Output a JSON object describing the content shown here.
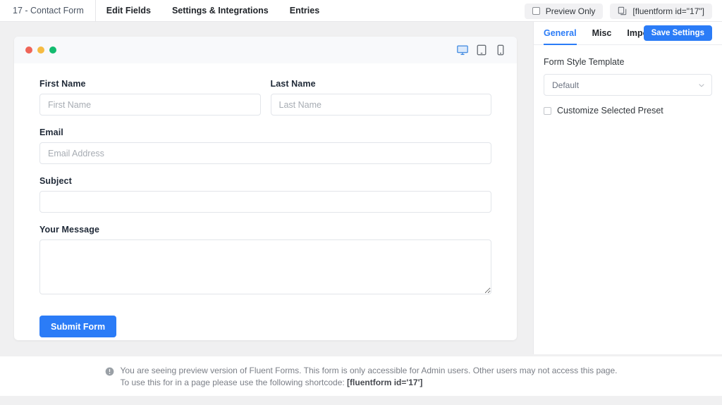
{
  "topbar": {
    "form_title": "17 - Contact Form",
    "nav": [
      {
        "label": "Edit Fields"
      },
      {
        "label": "Settings & Integrations"
      },
      {
        "label": "Entries"
      }
    ],
    "preview_only_label": "Preview Only",
    "shortcode_pill_label": "[fluentform id=\"17\"]"
  },
  "preview": {
    "devices": [
      {
        "name": "desktop",
        "active": true
      },
      {
        "name": "tablet",
        "active": false
      },
      {
        "name": "mobile",
        "active": false
      }
    ]
  },
  "form": {
    "first_name": {
      "label": "First Name",
      "placeholder": "First Name",
      "value": ""
    },
    "last_name": {
      "label": "Last Name",
      "placeholder": "Last Name",
      "value": ""
    },
    "email": {
      "label": "Email",
      "placeholder": "Email Address",
      "value": ""
    },
    "subject": {
      "label": "Subject",
      "placeholder": "",
      "value": ""
    },
    "message": {
      "label": "Your Message",
      "placeholder": "",
      "value": ""
    },
    "submit_label": "Submit Form"
  },
  "panel": {
    "tabs": [
      {
        "label": "General",
        "active": true
      },
      {
        "label": "Misc",
        "active": false
      },
      {
        "label": "Import",
        "active": false
      }
    ],
    "save_label": "Save Settings",
    "style_template_label": "Form Style Template",
    "style_template_value": "Default",
    "customize_label": "Customize Selected Preset"
  },
  "notice": {
    "line1": "You are seeing preview version of Fluent Forms. This form is only accessible for Admin users. Other users may not access this page.",
    "line2_prefix": "To use this for in a page please use the following shortcode: ",
    "line2_shortcode": "[fluentform id='17']"
  },
  "colors": {
    "accent": "#2b7cf7",
    "page_bg": "#f0f0f1",
    "card_bg": "#ffffff",
    "dot_red": "#ef6558",
    "dot_yellow": "#f6bb42",
    "dot_green": "#13bb6f"
  }
}
